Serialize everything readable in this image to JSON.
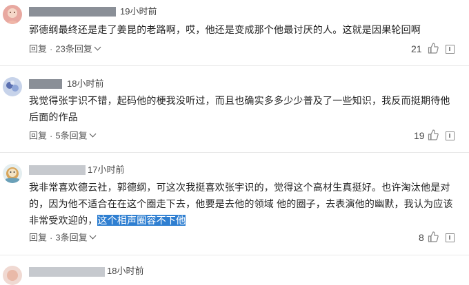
{
  "comments": [
    {
      "time": "19小时前",
      "text": "郭德纲最终还是走了姜昆的老路啊，哎，他还是变成那个他最讨厌的人。这就是因果轮回啊",
      "reply_label": "回复",
      "replies_label": "23条回复",
      "likes": "21"
    },
    {
      "time": "18小时前",
      "text": "我觉得张宇识不错，起码他的梗我没听过，而且也确实多多少少普及了一些知识，我反而挺期待他后面的作品",
      "reply_label": "回复",
      "replies_label": "5条回复",
      "likes": "19"
    },
    {
      "time": "17小时前",
      "text": "我非常喜欢德云社，郭德纲，可这次我挺喜欢张宇识的，觉得这个高材生真挺好。也许淘汰他是对的，因为他不适合在在这个圈走下去，他要是去他的领域 他的圈子，去表演他的幽默，我认为应该非常受欢迎的，",
      "highlight": "这个相声圈容不下他",
      "reply_label": "回复",
      "replies_label": "3条回复",
      "likes": "8"
    },
    {
      "time": "18小时前"
    }
  ]
}
